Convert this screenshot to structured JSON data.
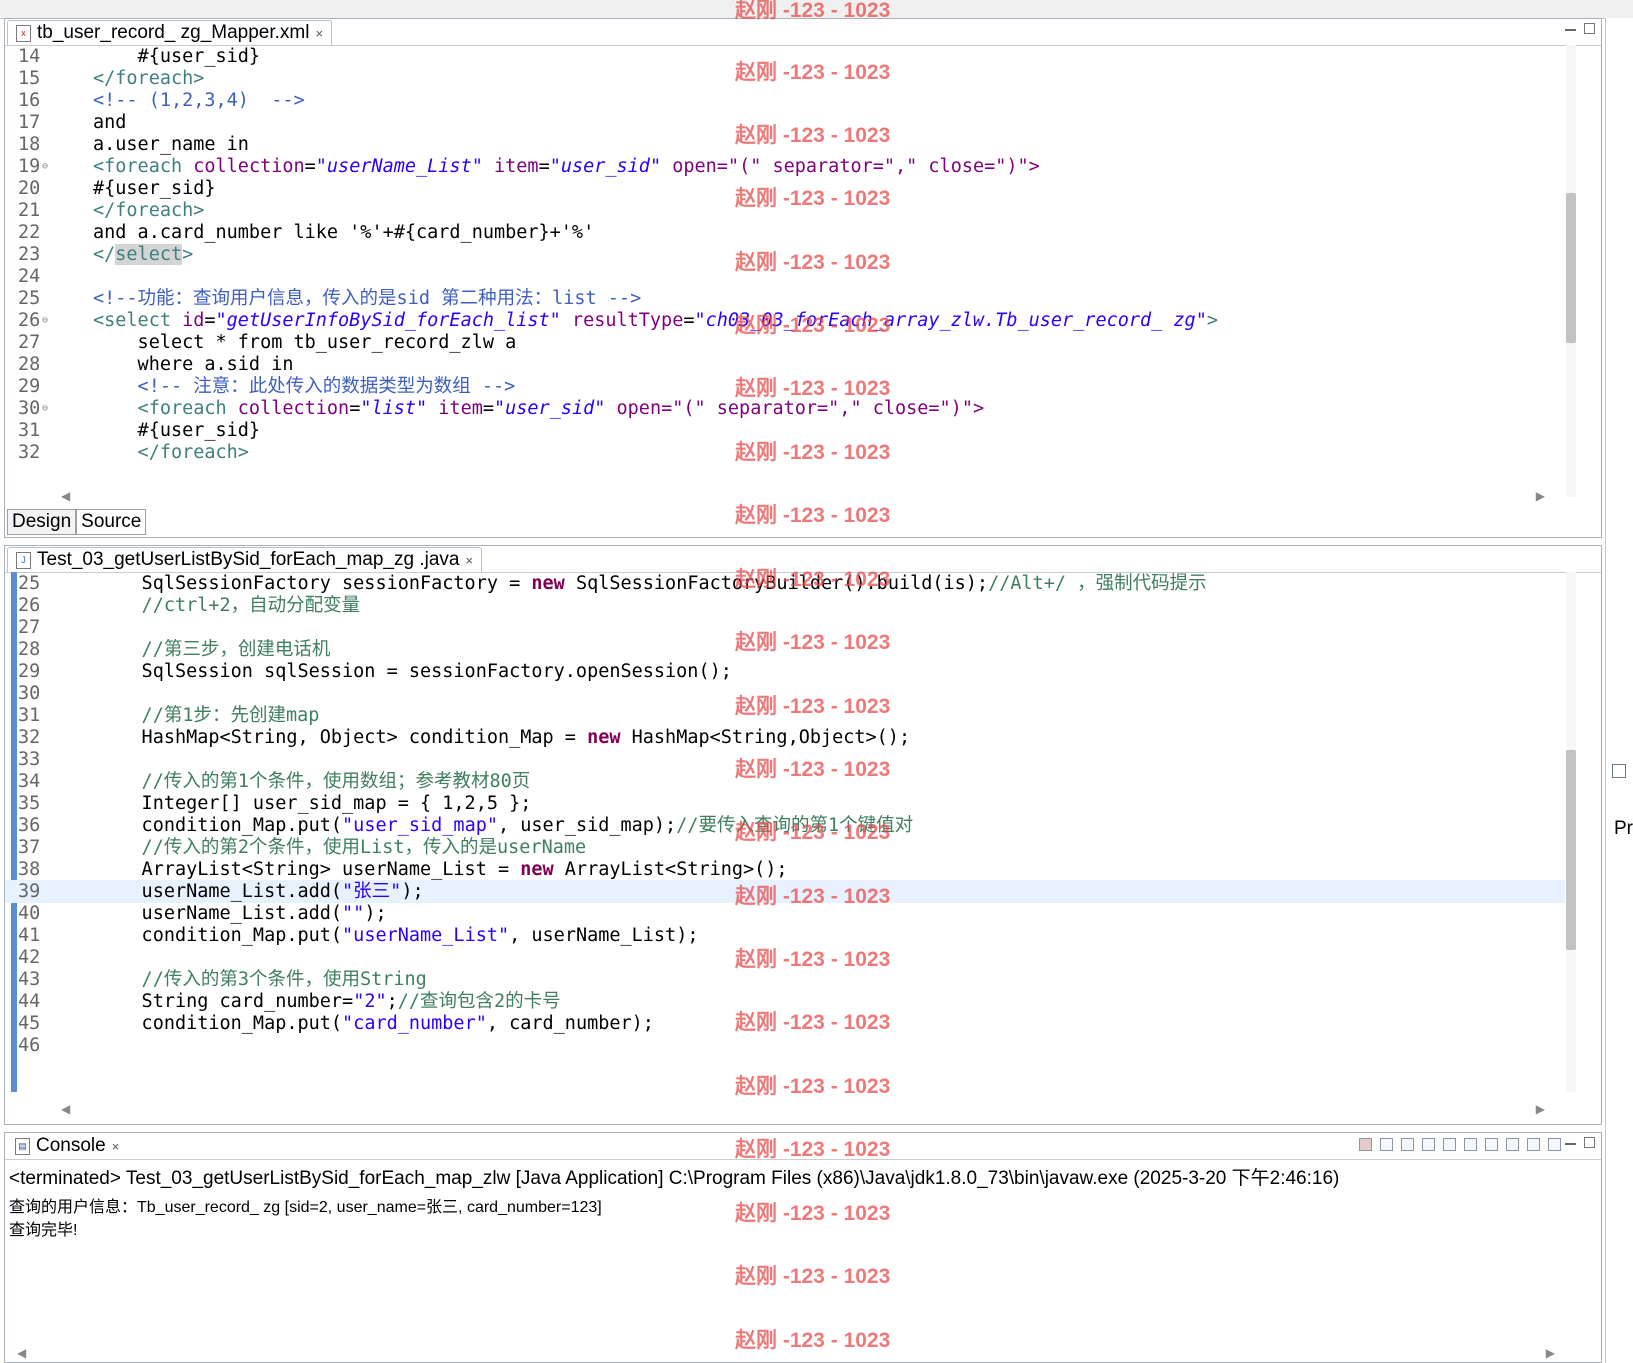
{
  "editor1": {
    "tab_title": "tb_user_record_ zg_Mapper.xml",
    "tab_close": "×",
    "bottom_tabs": [
      "Design",
      "Source"
    ],
    "lines": [
      {
        "n": "14",
        "tokens": [
          {
            "t": "    #{user_sid}",
            "c": ""
          }
        ]
      },
      {
        "n": "15",
        "tokens": [
          {
            "t": "</foreach>",
            "c": "tag"
          }
        ]
      },
      {
        "n": "16",
        "tokens": [
          {
            "t": "<!-- (1,2,3,4)  -->",
            "c": "cmt"
          }
        ]
      },
      {
        "n": "17",
        "tokens": [
          {
            "t": "and",
            "c": ""
          }
        ]
      },
      {
        "n": "18",
        "tokens": [
          {
            "t": "a.user_name in",
            "c": ""
          }
        ]
      },
      {
        "n": "19",
        "fold": true,
        "tokens": [
          {
            "t": "<foreach ",
            "c": "tag"
          },
          {
            "t": "collection",
            "c": "attr"
          },
          {
            "t": "=",
            "c": ""
          },
          {
            "t": "\"userName_List\"",
            "c": "str"
          },
          {
            "t": " item",
            "c": "attr"
          },
          {
            "t": "=",
            "c": ""
          },
          {
            "t": "\"user_sid\"",
            "c": "str"
          },
          {
            "t": " open",
            "c": "attr"
          },
          {
            "t": "=\"(\" separator=\",\" close=\")\">",
            "c": "mix"
          }
        ]
      },
      {
        "n": "20",
        "tokens": [
          {
            "t": "#{user_sid}",
            "c": ""
          }
        ]
      },
      {
        "n": "21",
        "tokens": [
          {
            "t": "</foreach>",
            "c": "tag"
          }
        ]
      },
      {
        "n": "22",
        "tokens": [
          {
            "t": "and a.card_number like '%'+#{card_number}+'%'",
            "c": ""
          }
        ]
      },
      {
        "n": "23",
        "tokens": [
          {
            "t": "</",
            "c": "tag"
          },
          {
            "t": "select",
            "c": "tag sel"
          },
          {
            "t": ">",
            "c": "tag"
          }
        ]
      },
      {
        "n": "24",
        "tokens": []
      },
      {
        "n": "25",
        "tokens": [
          {
            "t": "<!--功能：查询用户信息，传入的是sid 第二种用法：list -->",
            "c": "cmt"
          }
        ]
      },
      {
        "n": "26",
        "fold": true,
        "tokens": [
          {
            "t": "<select ",
            "c": "tag"
          },
          {
            "t": "id",
            "c": "attr"
          },
          {
            "t": "=",
            "c": ""
          },
          {
            "t": "\"getUserInfoBySid_forEach_list\"",
            "c": "str"
          },
          {
            "t": " resultType",
            "c": "attr"
          },
          {
            "t": "=",
            "c": ""
          },
          {
            "t": "\"ch03_03_forEach_array_zlw.Tb_user_record_ zg\"",
            "c": "str"
          },
          {
            "t": ">",
            "c": "tag"
          }
        ]
      },
      {
        "n": "27",
        "tokens": [
          {
            "t": "    select * from tb_user_record_zlw a",
            "c": ""
          }
        ]
      },
      {
        "n": "28",
        "tokens": [
          {
            "t": "    where a.sid in",
            "c": ""
          }
        ]
      },
      {
        "n": "29",
        "tokens": [
          {
            "t": "    <!-- 注意：此处传入的数据类型为数组 -->",
            "c": "cmt"
          }
        ]
      },
      {
        "n": "30",
        "fold": true,
        "tokens": [
          {
            "t": "    <foreach ",
            "c": "tag"
          },
          {
            "t": "collection",
            "c": "attr"
          },
          {
            "t": "=",
            "c": ""
          },
          {
            "t": "\"list\"",
            "c": "str"
          },
          {
            "t": " item",
            "c": "attr"
          },
          {
            "t": "=",
            "c": ""
          },
          {
            "t": "\"user_sid\"",
            "c": "str"
          },
          {
            "t": " open",
            "c": "attr"
          },
          {
            "t": "=\"(\" separator=\",\" close=\")\">",
            "c": "mix"
          }
        ]
      },
      {
        "n": "31",
        "tokens": [
          {
            "t": "    #{user_sid}",
            "c": ""
          }
        ]
      },
      {
        "n": "32",
        "tokens": [
          {
            "t": "    </foreach>",
            "c": "tag"
          }
        ]
      }
    ]
  },
  "editor2": {
    "tab_title": "Test_03_getUserListBySid_forEach_map_zg .java",
    "tab_close": "×",
    "lines": [
      {
        "n": "25",
        "tokens": [
          {
            "t": "    SqlSessionFactory sessionFactory = ",
            "c": ""
          },
          {
            "t": "new",
            "c": "kw"
          },
          {
            "t": " SqlSessionFactoryBuilder().build(is);",
            "c": ""
          },
          {
            "t": "//Alt+/ ，强制代码提示",
            "c": "jcmt"
          }
        ]
      },
      {
        "n": "26",
        "tokens": [
          {
            "t": "    //ctrl+2，自动分配变量",
            "c": "jcmt"
          }
        ]
      },
      {
        "n": "27",
        "tokens": []
      },
      {
        "n": "28",
        "tokens": [
          {
            "t": "    //第三步，创建电话机",
            "c": "jcmt"
          }
        ]
      },
      {
        "n": "29",
        "tokens": [
          {
            "t": "    SqlSession sqlSession = sessionFactory.openSession();",
            "c": ""
          }
        ]
      },
      {
        "n": "30",
        "tokens": []
      },
      {
        "n": "31",
        "tokens": [
          {
            "t": "    //第1步：先创建map",
            "c": "jcmt"
          }
        ]
      },
      {
        "n": "32",
        "tokens": [
          {
            "t": "    HashMap<String, Object> condition_Map = ",
            "c": ""
          },
          {
            "t": "new",
            "c": "kw"
          },
          {
            "t": " HashMap<String,Object>();",
            "c": ""
          }
        ]
      },
      {
        "n": "33",
        "tokens": []
      },
      {
        "n": "34",
        "tokens": [
          {
            "t": "    //传入的第1个条件，使用数组；参考教材80页",
            "c": "jcmt"
          }
        ]
      },
      {
        "n": "35",
        "tokens": [
          {
            "t": "    Integer[] user_sid_map = { 1,2,5 };",
            "c": ""
          }
        ]
      },
      {
        "n": "36",
        "tokens": [
          {
            "t": "    condition_Map.put(",
            "c": ""
          },
          {
            "t": "\"user_sid_map\"",
            "c": "jstr"
          },
          {
            "t": ", user_sid_map);",
            "c": ""
          },
          {
            "t": "//要传入查询的第1个键值对",
            "c": "jcmt"
          }
        ]
      },
      {
        "n": "37",
        "tokens": [
          {
            "t": "    //传入的第2个条件，使用List，传入的是userName",
            "c": "jcmt"
          }
        ]
      },
      {
        "n": "38",
        "tokens": [
          {
            "t": "    ArrayList<String> userName_List = ",
            "c": ""
          },
          {
            "t": "new",
            "c": "kw"
          },
          {
            "t": " ArrayList<String>();",
            "c": ""
          }
        ]
      },
      {
        "n": "39",
        "hl": true,
        "tokens": [
          {
            "t": "    userName_List.add(",
            "c": ""
          },
          {
            "t": "\"张三\"",
            "c": "jstr"
          },
          {
            "t": ");",
            "c": ""
          }
        ]
      },
      {
        "n": "40",
        "tokens": [
          {
            "t": "    userName_List.add(",
            "c": ""
          },
          {
            "t": "\"\"",
            "c": "jstr"
          },
          {
            "t": ");",
            "c": ""
          }
        ]
      },
      {
        "n": "41",
        "tokens": [
          {
            "t": "    condition_Map.put(",
            "c": ""
          },
          {
            "t": "\"userName_List\"",
            "c": "jstr"
          },
          {
            "t": ", userName_List);",
            "c": ""
          }
        ]
      },
      {
        "n": "42",
        "tokens": []
      },
      {
        "n": "43",
        "tokens": [
          {
            "t": "    //传入的第3个条件，使用String",
            "c": "jcmt"
          }
        ]
      },
      {
        "n": "44",
        "tokens": [
          {
            "t": "    String card_number=",
            "c": ""
          },
          {
            "t": "\"2\"",
            "c": "jstr"
          },
          {
            "t": ";",
            "c": ""
          },
          {
            "t": "//查询包含2的卡号",
            "c": "jcmt"
          }
        ]
      },
      {
        "n": "45",
        "tokens": [
          {
            "t": "    condition_Map.put(",
            "c": ""
          },
          {
            "t": "\"card_number\"",
            "c": "jstr"
          },
          {
            "t": ", card_number);",
            "c": ""
          }
        ]
      },
      {
        "n": "46",
        "tokens": []
      }
    ]
  },
  "console": {
    "tab_title": "Console",
    "tab_close": "×",
    "terminated": "<terminated> Test_03_getUserListBySid_forEach_map_zlw [Java Application] C:\\Program Files (x86)\\Java\\jdk1.8.0_73\\bin\\javaw.exe (2025-3-20 下午2:46:16)",
    "output": [
      "查询的用户信息：Tb_user_record_ zg [sid=2, user_name=张三, card_number=123]",
      "查询完毕!"
    ]
  },
  "right_panel": {
    "label": "Pr"
  },
  "watermark": "赵刚 -123 - 1023",
  "colors": {
    "tag": "#3f7f7f",
    "attr": "#7f007f",
    "string": "#2a00ff",
    "comment": "#3f5fbf",
    "java_comment": "#3f7f5f",
    "keyword": "#7f0055",
    "current_line": "#e8f2fe",
    "watermark": "#e64646"
  }
}
